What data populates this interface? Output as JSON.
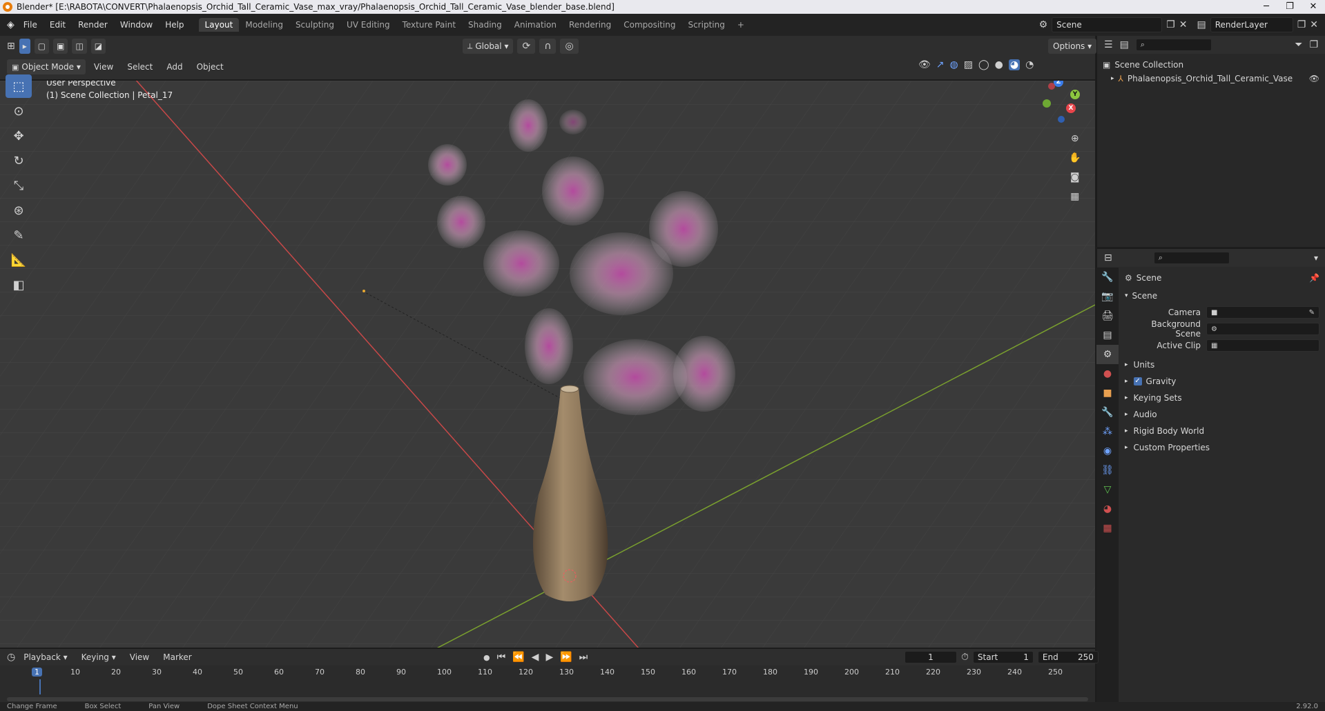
{
  "window": {
    "title": "Blender* [E:\\RABOTA\\CONVERT\\Phalaenopsis_Orchid_Tall_Ceramic_Vase_max_vray/Phalaenopsis_Orchid_Tall_Ceramic_Vase_blender_base.blend]",
    "min": "─",
    "max": "❐",
    "close": "✕"
  },
  "menu": [
    "File",
    "Edit",
    "Render",
    "Window",
    "Help"
  ],
  "workspaces": [
    "Layout",
    "Modeling",
    "Sculpting",
    "UV Editing",
    "Texture Paint",
    "Shading",
    "Animation",
    "Rendering",
    "Compositing",
    "Scripting"
  ],
  "active_workspace": "Layout",
  "scene_field": "Scene",
  "render_layer_field": "RenderLayer",
  "viewport_header": {
    "transform_orientation": "Global",
    "options": "Options",
    "mode": "Object Mode",
    "menus": [
      "View",
      "Select",
      "Add",
      "Object"
    ]
  },
  "viewport": {
    "perspective": "User Perspective",
    "context": "(1) Scene Collection | Petal_17",
    "gizmo_axes": [
      "Z",
      "Y",
      "X"
    ]
  },
  "outliner": {
    "root": "Scene Collection",
    "items": [
      "Phalaenopsis_Orchid_Tall_Ceramic_Vase"
    ]
  },
  "properties": {
    "context": "Scene",
    "panel_title": "Scene",
    "fields": [
      {
        "label": "Camera",
        "value": ""
      },
      {
        "label": "Background Scene",
        "value": ""
      },
      {
        "label": "Active Clip",
        "value": ""
      }
    ],
    "sections": [
      {
        "label": "Units",
        "checkbox": false
      },
      {
        "label": "Gravity",
        "checkbox": true
      },
      {
        "label": "Keying Sets",
        "checkbox": false
      },
      {
        "label": "Audio",
        "checkbox": false
      },
      {
        "label": "Rigid Body World",
        "checkbox": false
      },
      {
        "label": "Custom Properties",
        "checkbox": false
      }
    ]
  },
  "timeline": {
    "menus": [
      "Playback",
      "Keying",
      "View",
      "Marker"
    ],
    "current_frame": "1",
    "start_label": "Start",
    "start": "1",
    "end_label": "End",
    "end": "250",
    "ruler": [
      "10",
      "20",
      "30",
      "40",
      "50",
      "60",
      "70",
      "80",
      "90",
      "100",
      "110",
      "120",
      "130",
      "140",
      "150",
      "160",
      "170",
      "180",
      "190",
      "200",
      "210",
      "220",
      "230",
      "240",
      "250"
    ],
    "playhead": "1"
  },
  "status": {
    "items": [
      "Change Frame",
      "Box Select",
      "Pan View",
      "Dope Sheet Context Menu"
    ],
    "version": "2.92.0"
  }
}
